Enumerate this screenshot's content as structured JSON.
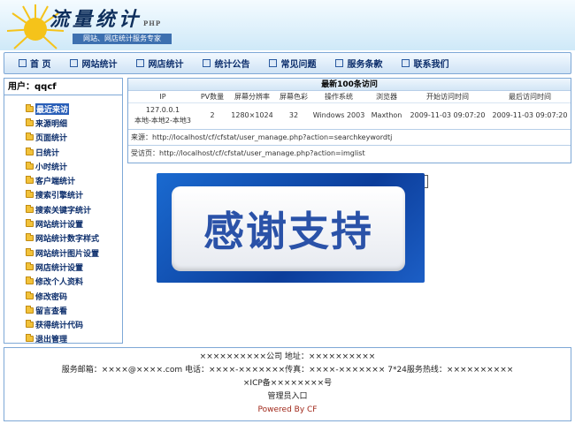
{
  "header": {
    "logo_text": "流量统计",
    "logo_sub": "PHP",
    "slogan": "网站、网店统计服务专家"
  },
  "nav": {
    "items": [
      {
        "label": "首 页"
      },
      {
        "label": "网站统计"
      },
      {
        "label": "网店统计"
      },
      {
        "label": "统计公告"
      },
      {
        "label": "常见问题"
      },
      {
        "label": "服务条款"
      },
      {
        "label": "联系我们"
      }
    ]
  },
  "sidebar": {
    "user_label": "用户：",
    "username": "qqcf",
    "items": [
      {
        "label": "最近来访",
        "active": true
      },
      {
        "label": "来源明细"
      },
      {
        "label": "页面统计"
      },
      {
        "label": "日统计"
      },
      {
        "label": "小时统计"
      },
      {
        "label": "客户端统计"
      },
      {
        "label": "搜索引擎统计"
      },
      {
        "label": "搜索关键字统计"
      },
      {
        "label": "网站统计设置"
      },
      {
        "label": "网站统计数字样式"
      },
      {
        "label": "网站统计图片设置"
      },
      {
        "label": "网店统计设置"
      },
      {
        "label": "修改个人资料"
      },
      {
        "label": "修改密码"
      },
      {
        "label": "留言查看"
      },
      {
        "label": "获得统计代码"
      },
      {
        "label": "退出管理"
      }
    ]
  },
  "visits": {
    "title": "最新100条访问",
    "columns": [
      "IP",
      "PV数量",
      "屏幕分辨率",
      "屏幕色彩",
      "操作系统",
      "浏览器",
      "开始访问时间",
      "最后访问时间"
    ],
    "rows": [
      {
        "ip": "127.0.0.1",
        "location": "本地-本地2-本地3",
        "pv": "2",
        "resolution": "1280×1024",
        "color": "32",
        "os": "Windows 2003",
        "browser": "Maxthon",
        "start": "2009-11-03 09:07:20",
        "last": "2009-11-03 09:07:20"
      }
    ],
    "source_label": "来源：",
    "source_url": "http://localhost/cf/cfstat/user_manage.php?action=searchkeywordtj",
    "visited_label": "受访页：",
    "visited_url": "http://localhost/cf/cfstat/user_manage.php?action=imglist"
  },
  "banner": {
    "text": "感谢支持"
  },
  "footer": {
    "company": "××××××××××公司 地址：××××××××××",
    "contact": "服务邮箱：××××@××××.com 电话：××××-×××××××传真：××××-××××××× 7*24服务热线：××××××××××",
    "icp": "×ICP备××××××××号",
    "admin_link": "管理员入口",
    "powered": "Powered By CF"
  },
  "colors": {
    "accent": "#2a5fb8",
    "border": "#7ea8d6",
    "nav_text": "#0b2d6b",
    "powered": "#a0281a"
  }
}
